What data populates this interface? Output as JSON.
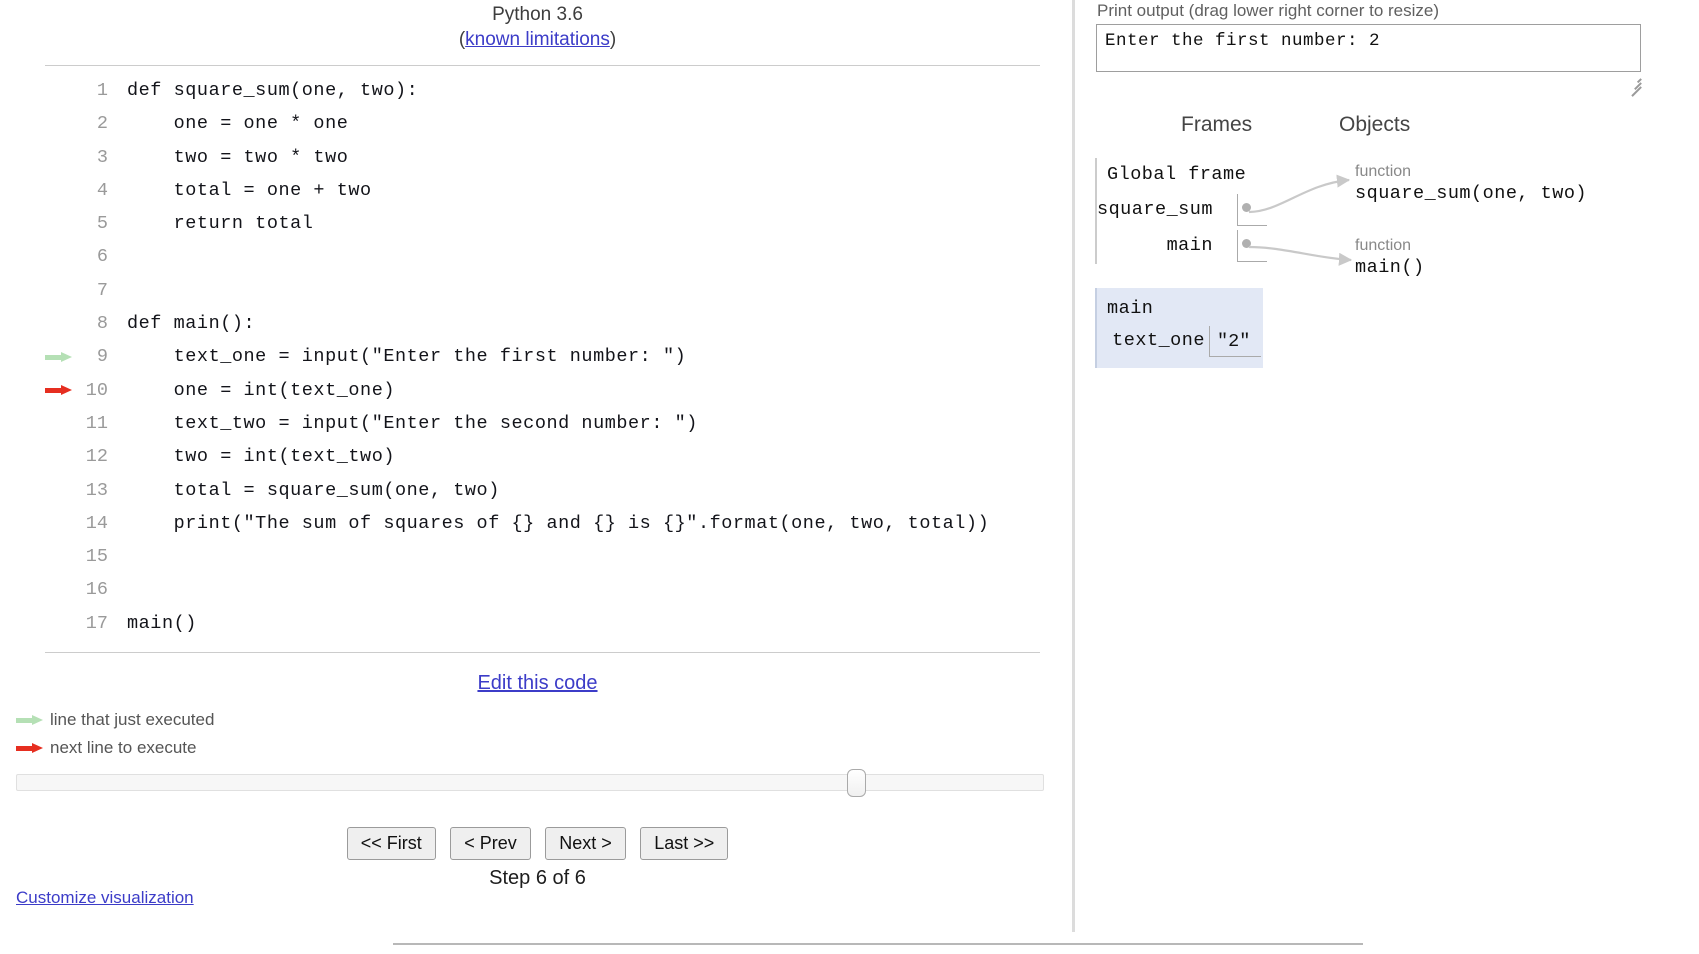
{
  "header": {
    "python_version": "Python 3.6",
    "limitations_prefix": "(",
    "limitations_link": "known limitations",
    "limitations_suffix": ")"
  },
  "code": {
    "lines": [
      {
        "num": "1",
        "text": "def square_sum(one, two):",
        "marker": "none"
      },
      {
        "num": "2",
        "text": "    one = one * one",
        "marker": "none"
      },
      {
        "num": "3",
        "text": "    two = two * two",
        "marker": "none"
      },
      {
        "num": "4",
        "text": "    total = one + two",
        "marker": "none"
      },
      {
        "num": "5",
        "text": "    return total",
        "marker": "none"
      },
      {
        "num": "6",
        "text": "",
        "marker": "none"
      },
      {
        "num": "7",
        "text": "",
        "marker": "none"
      },
      {
        "num": "8",
        "text": "def main():",
        "marker": "none"
      },
      {
        "num": "9",
        "text": "    text_one = input(\"Enter the first number: \")",
        "marker": "executed"
      },
      {
        "num": "10",
        "text": "    one = int(text_one)",
        "marker": "next"
      },
      {
        "num": "11",
        "text": "    text_two = input(\"Enter the second number: \")",
        "marker": "none"
      },
      {
        "num": "12",
        "text": "    two = int(text_two)",
        "marker": "none"
      },
      {
        "num": "13",
        "text": "    total = square_sum(one, two)",
        "marker": "none"
      },
      {
        "num": "14",
        "text": "    print(\"The sum of squares of {} and {} is {}\".format(one, two, total))",
        "marker": "none"
      },
      {
        "num": "15",
        "text": "",
        "marker": "none"
      },
      {
        "num": "16",
        "text": "",
        "marker": "none"
      },
      {
        "num": "17",
        "text": "main()",
        "marker": "none"
      }
    ]
  },
  "edit_code_link": "Edit this code",
  "legend": {
    "executed_label": "line that just executed",
    "next_label": "next line to execute",
    "executed_color": "#b5e0b5",
    "next_color": "#e62e20"
  },
  "controls": {
    "first_label": "<< First",
    "prev_label": "< Prev",
    "next_label": "Next >",
    "last_label": "Last >>",
    "step_label": "Step 6 of 6",
    "current_step": 6,
    "total_steps": 6
  },
  "customize_link": "Customize visualization",
  "print_output": {
    "label": "Print output (drag lower right corner to resize)",
    "value": "Enter the first number: 2"
  },
  "visualization": {
    "frames_header": "Frames",
    "objects_header": "Objects",
    "global_frame": {
      "title": "Global frame",
      "variables": [
        {
          "name": "square_sum",
          "value": ""
        },
        {
          "name": "main",
          "value": ""
        }
      ]
    },
    "active_frame": {
      "title": "main",
      "highlight_color": "#e2e8f5",
      "variables": [
        {
          "name": "text_one",
          "value": "\"2\""
        }
      ]
    },
    "objects": [
      {
        "type": "function",
        "label": "square_sum(one, two)"
      },
      {
        "type": "function",
        "label": "main()"
      }
    ]
  }
}
